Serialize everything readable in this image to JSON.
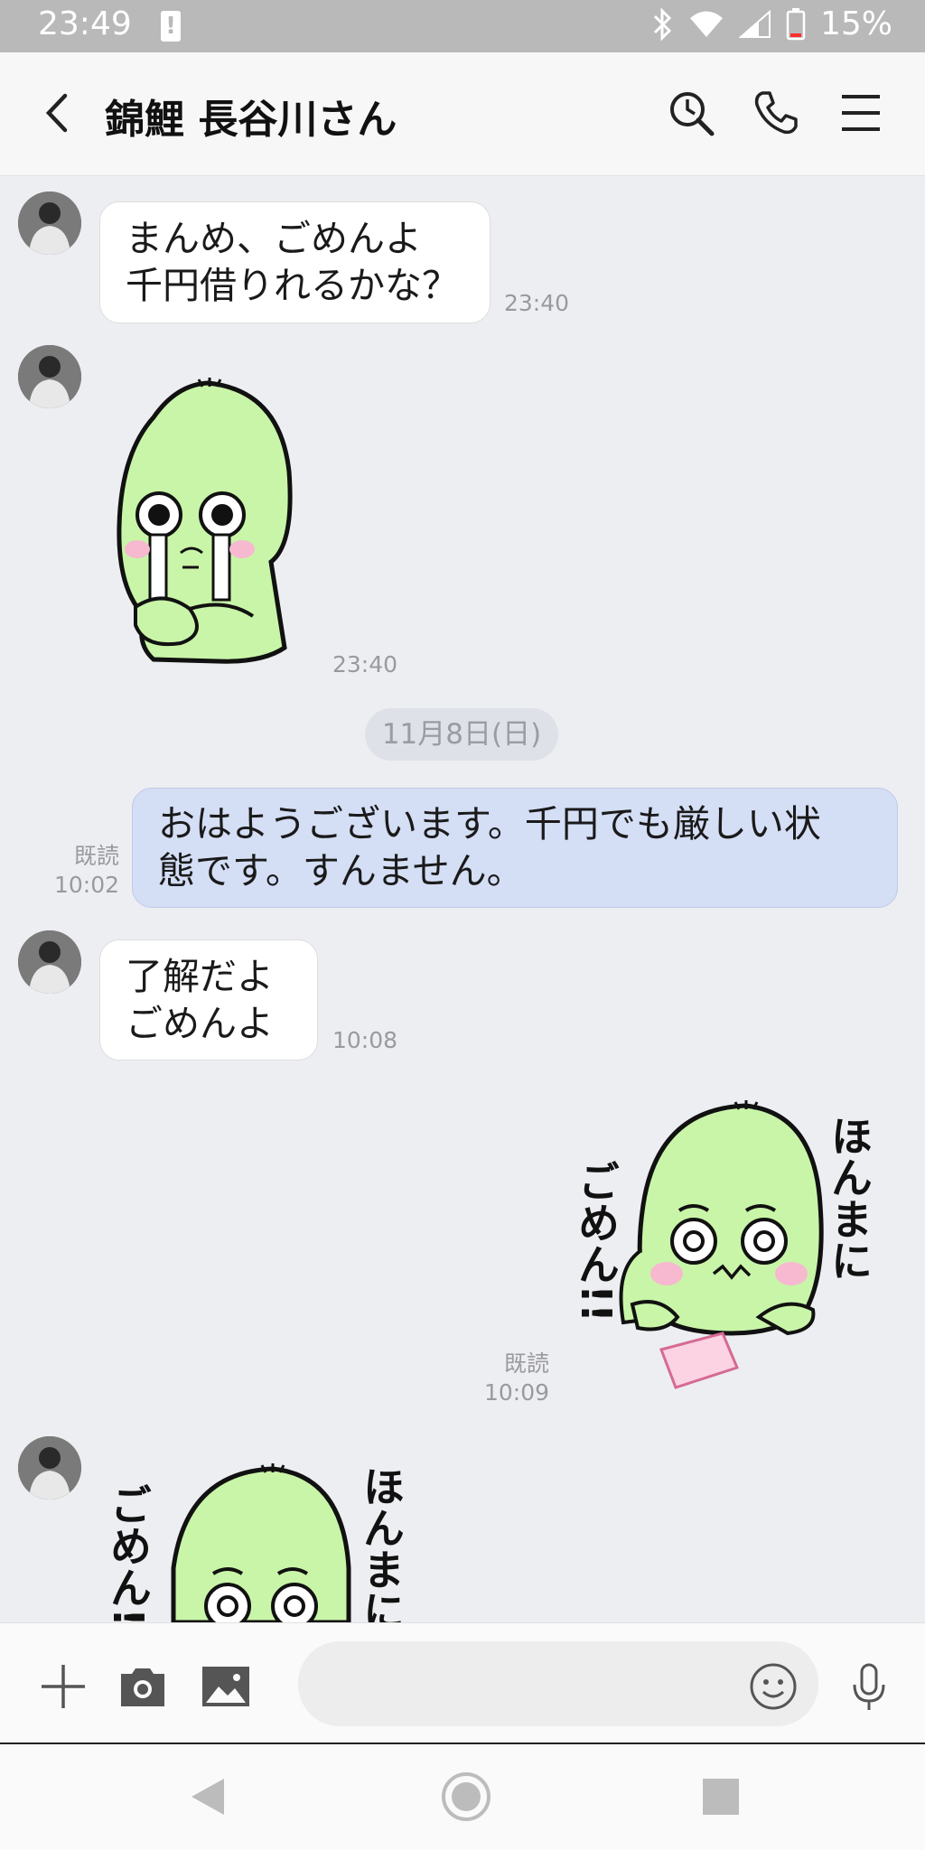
{
  "status_bar": {
    "time": "23:49",
    "battery": "15%",
    "icons": [
      "battery-alert-icon",
      "bluetooth-icon",
      "wifi-icon",
      "signal-icon",
      "battery-icon"
    ]
  },
  "header": {
    "back_icon": "chevron-left-icon",
    "contact_name": "錦鯉 長谷川さん",
    "icons": [
      "search-history-icon",
      "phone-icon",
      "menu-icon"
    ]
  },
  "messages": [
    {
      "sender": "other",
      "lines": [
        "まんめ、ごめんよ",
        "千円借りれるかな？"
      ],
      "time": "23:40"
    },
    {
      "sender": "other",
      "sticker": "crying-green-character-sticker",
      "time": "23:40"
    },
    {
      "date_separator": "11月8日(日)"
    },
    {
      "sender": "me",
      "lines": [
        "おはようございます。千円でも厳しい状",
        "態です。すんません。"
      ],
      "read": "既読",
      "time": "10:02"
    },
    {
      "sender": "other",
      "lines": [
        "了解だよ",
        "ごめんよ"
      ],
      "time": "10:08"
    },
    {
      "sender": "me",
      "sticker": "apology-green-character-sticker",
      "sticker_text": [
        "ごめん!!",
        "ほんまに"
      ],
      "read": "既読",
      "time": "10:09"
    },
    {
      "sender": "other",
      "sticker": "apology-green-character-sticker",
      "sticker_text": [
        "ごめん!!",
        "ほんまに"
      ]
    }
  ],
  "input_bar": {
    "icons": [
      "plus-icon",
      "camera-icon",
      "image-icon",
      "emoji-icon",
      "microphone-icon"
    ],
    "placeholder": ""
  },
  "nav_bar": {
    "icons": [
      "nav-back-icon",
      "nav-home-icon",
      "nav-recents-icon"
    ]
  },
  "colors": {
    "background": "#edeef2",
    "my_bubble": "#d4def5",
    "other_bubble": "#ffffff",
    "sticker_green": "#c9f5a8"
  }
}
